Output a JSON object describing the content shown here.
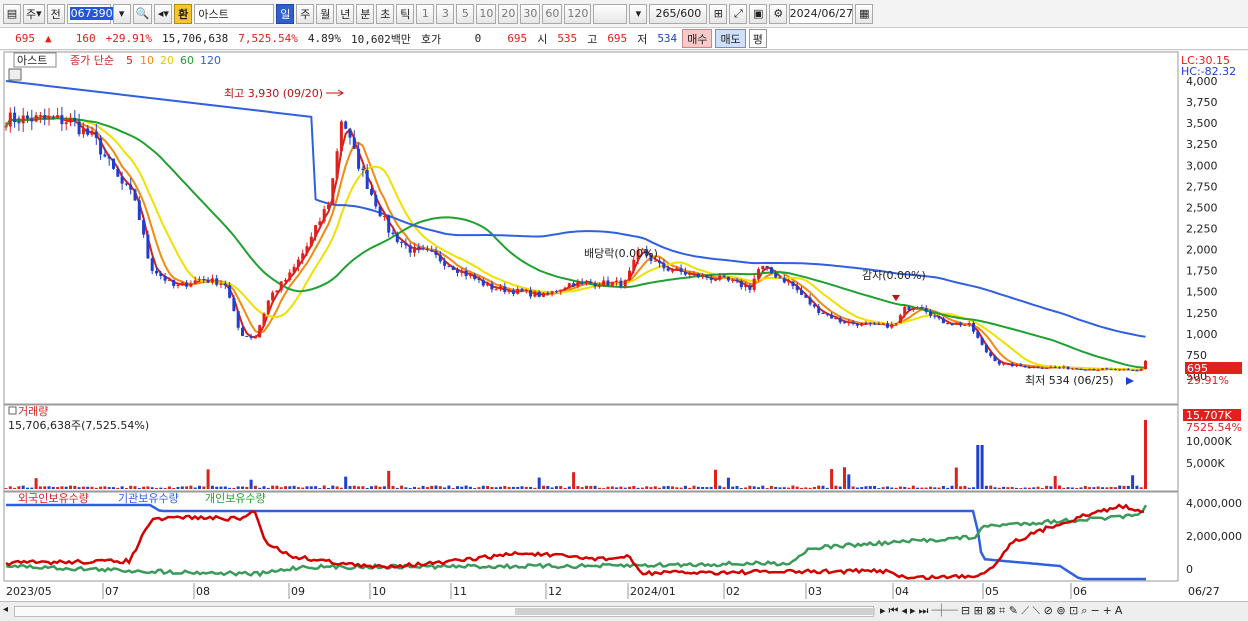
{
  "toolbar": {
    "type_label": "주",
    "prev_label": "전",
    "code": "067390",
    "hwan": "환",
    "name": "아스트",
    "periods": [
      "일",
      "주",
      "월",
      "년",
      "분",
      "초",
      "틱"
    ],
    "counts": [
      "1",
      "3",
      "5",
      "10",
      "20",
      "30",
      "60",
      "120"
    ],
    "view_count": "265",
    "view_total": "/600",
    "date": "2024/06/27"
  },
  "quote": {
    "price": "695",
    "change": "160",
    "change_pct": "+29.91%",
    "volume": "15,706,638",
    "volume_pct": "7,525.54%",
    "turnover": "4.89%",
    "amount": "10,602백만",
    "hoga_label": "호가",
    "hoga_val": "0",
    "hoga_price": "695",
    "open_label": "시",
    "open": "535",
    "high_label": "고",
    "high": "695",
    "low_label": "저",
    "low": "534",
    "buy": "매수",
    "sell": "매도",
    "eval": "평"
  },
  "price_panel": {
    "name_tag": "아스트",
    "legend_main": "종가 단순",
    "ma": [
      {
        "period": "5",
        "color": "#d42020"
      },
      {
        "period": "10",
        "color": "#f08a10"
      },
      {
        "period": "20",
        "color": "#f0e000"
      },
      {
        "period": "60",
        "color": "#20a030"
      },
      {
        "period": "120",
        "color": "#3060e0"
      }
    ],
    "lc": "LC:30.15",
    "hc": "HC:-82.32",
    "y_ticks": [
      "4,000",
      "3,750",
      "3,500",
      "3,250",
      "3,000",
      "2,750",
      "2,500",
      "2,250",
      "2,000",
      "1,750",
      "1,500",
      "1,250",
      "1,000",
      "750",
      "500"
    ],
    "high_note": "최고 3,930 (09/20)",
    "low_note": "최저 534 (06/25)",
    "dividend_note": "배당락(0.00%)",
    "capred_note": "감자(0.00%)",
    "last_price": "695",
    "last_pct": "29.91%"
  },
  "volume_panel": {
    "title": "거래량",
    "value": "15,706,638주(7,525.54%)",
    "y_ticks": [
      "10,000K",
      "5,000K"
    ],
    "last": "15,707K",
    "last_pct": "7525.54%"
  },
  "holdings_panel": {
    "legend": [
      "외국인보유수량",
      "기관보유수량",
      "개인보유수량"
    ],
    "y_ticks": [
      "4,000,000",
      "2,000,000",
      "0"
    ]
  },
  "x_labels": [
    "2023/05",
    "07",
    "08",
    "09",
    "10",
    "11",
    "12",
    "2024/01",
    "02",
    "03",
    "04",
    "05",
    "06",
    "06/27"
  ],
  "colors": {
    "up": "#e0201b",
    "down": "#1f3fd0",
    "ma5": "#d42020",
    "ma10": "#f08a10",
    "ma20": "#f0e000",
    "ma60": "#20a030",
    "ma120": "#3060e0"
  }
}
